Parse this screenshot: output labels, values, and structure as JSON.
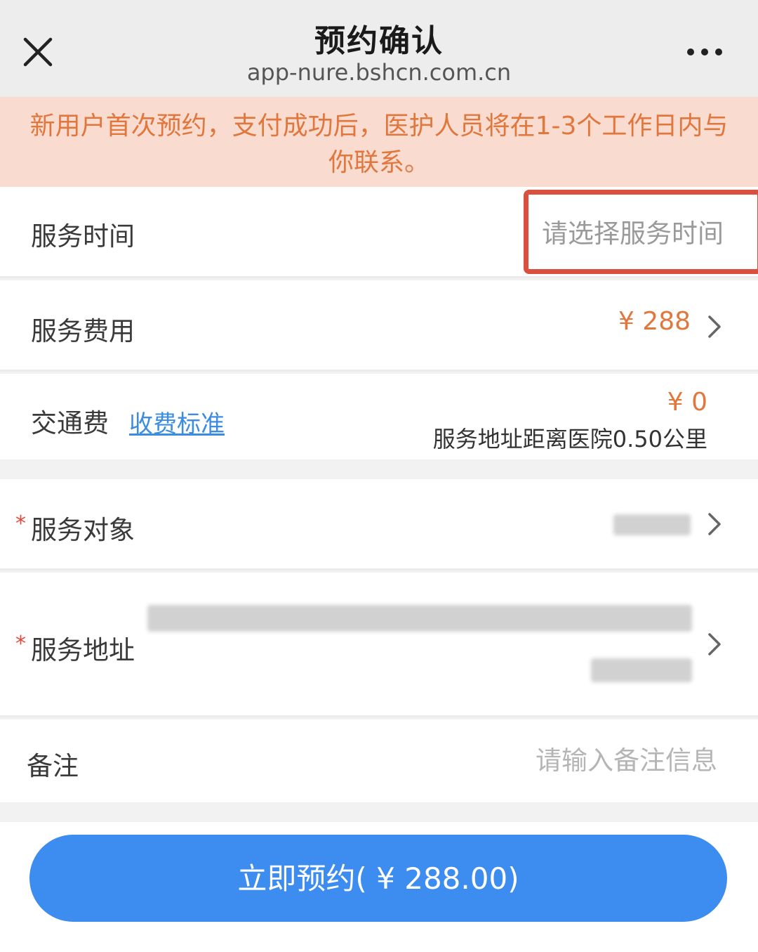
{
  "header": {
    "title": "预约确认",
    "url": "app-nure.bshcn.com.cn",
    "close_icon": "close-icon",
    "more_icon": "more-dots-icon"
  },
  "notice": {
    "text": "新用户首次预约，支付成功后，医护人员将在1-3个工作日内与你联系。"
  },
  "service_time": {
    "label": "服务时间",
    "placeholder": "请选择服务时间"
  },
  "service_fee": {
    "label": "服务费用",
    "value": "¥ 288"
  },
  "transport_fee": {
    "label": "交通费",
    "link": "收费标准",
    "value": "¥ 0",
    "note": "服务地址距离医院0.50公里"
  },
  "service_target": {
    "label": "服务对象",
    "required_mark": "*"
  },
  "service_address": {
    "label": "服务地址",
    "required_mark": "*"
  },
  "remark": {
    "label": "备注",
    "placeholder": "请输入备注信息"
  },
  "book_button": {
    "label": "立即预约( ¥ 288.00)"
  },
  "colors": {
    "accent_orange": "#e0773d",
    "notice_bg": "#fadbd0",
    "primary_blue": "#3d8cf0",
    "highlight_red": "#d9503e",
    "link_blue": "#3c8de0"
  }
}
